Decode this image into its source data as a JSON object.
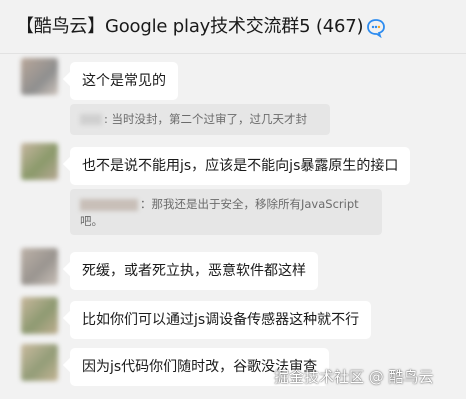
{
  "header": {
    "title": "【酷鸟云】Google play技术交流群5 (467)",
    "icon": "chat-bubble-icon"
  },
  "messages": [
    {
      "text": "这个是常见的",
      "quote": {
        "sender": "",
        "text": ": 当时没封，第二个过审了，过几天才封"
      }
    },
    {
      "text": "也不是说不能用js，应该是不能向js暴露原生的接口",
      "quote": {
        "sender": "",
        "text": "：那我还是出于安全，移除所有JavaScript 吧。"
      }
    },
    {
      "text": "死缓，或者死立执，恶意软件都这样"
    },
    {
      "text": "比如你们可以通过js调设备传感器这种就不行"
    },
    {
      "text": "因为js代码你们随时改，谷歌没法审查"
    }
  ],
  "watermark": "掘金技术社区 @ 酷鸟云",
  "colors": {
    "background": "#f2f2f2",
    "bubble": "#ffffff",
    "quote": "#e6e6e6",
    "accent": "#2d8cf0"
  }
}
